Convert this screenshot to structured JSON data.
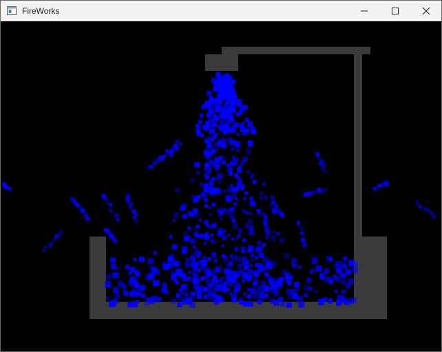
{
  "window": {
    "title": "FireWorks",
    "controls": {
      "minimize_icon": "minimize-icon",
      "maximize_icon": "maximize-icon",
      "close_icon": "close-icon"
    }
  },
  "scene": {
    "background_color": "#000000",
    "structure_color": "#3a3a3a",
    "particle_color": "#0000ff"
  }
}
